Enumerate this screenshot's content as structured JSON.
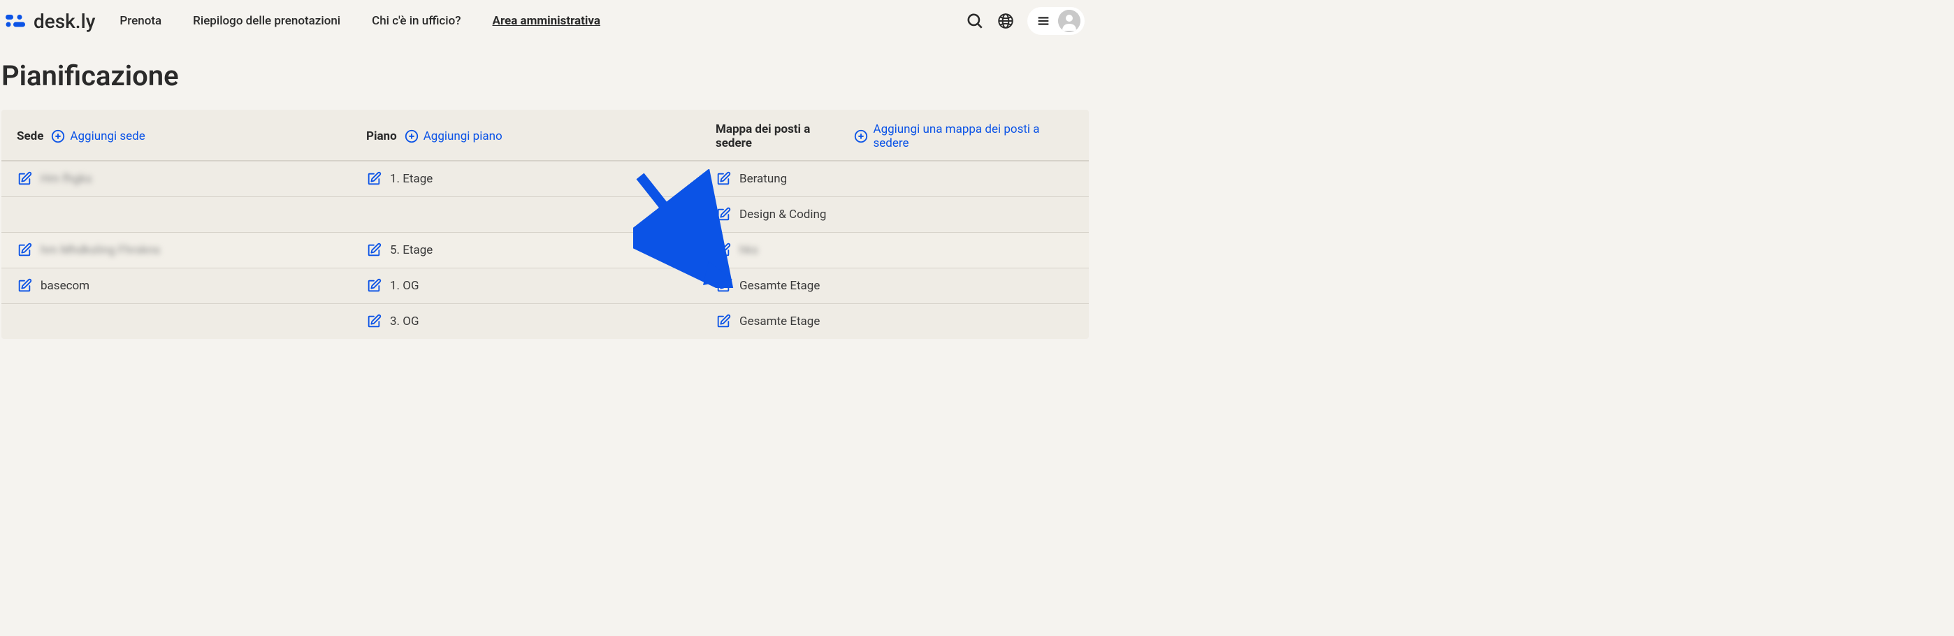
{
  "header": {
    "logo_text": "desk.ly",
    "nav": {
      "book": "Prenota",
      "summary": "Riepilogo delle prenotazioni",
      "who": "Chi c'è in ufficio?",
      "admin": "Area amministrativa"
    }
  },
  "page": {
    "title": "Pianificazione"
  },
  "columns": {
    "sede": {
      "label": "Sede",
      "add": "Aggiungi sede"
    },
    "piano": {
      "label": "Piano",
      "add": "Aggiungi piano"
    },
    "mappa": {
      "label": "Mappa dei posti a sedere",
      "add": "Aggiungi una mappa dei posti a sedere"
    }
  },
  "rows": [
    {
      "sede": "Hm fhgks",
      "sede_blurred": true,
      "piano": "1. Etage",
      "mappa": "Beratung"
    },
    {
      "sede": "",
      "piano": "",
      "mappa": "Design & Coding"
    },
    {
      "sede": "hm Mhdksling Fhrskns",
      "sede_blurred": true,
      "piano": "5. Etage",
      "mappa": "hks",
      "mappa_blurred": true,
      "alt": true
    },
    {
      "sede": "basecom",
      "piano": "1. OG",
      "mappa": "Gesamte Etage"
    },
    {
      "sede": "",
      "piano": "3. OG",
      "mappa": "Gesamte Etage"
    }
  ],
  "icons": {
    "search": "search-icon",
    "globe": "globe-icon",
    "menu": "menu-icon",
    "avatar": "avatar-icon",
    "plus": "plus-circle-icon",
    "edit": "edit-icon"
  },
  "colors": {
    "link": "#0b53e6",
    "arrow": "#0b53e6"
  }
}
